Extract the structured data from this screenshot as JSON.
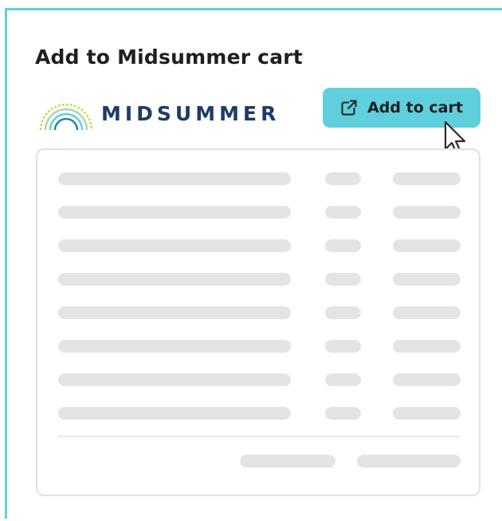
{
  "panel": {
    "title": "Add to Midsummer cart"
  },
  "brand": {
    "name": "MIDSUMMER",
    "logo_icon": "midsummer-arc-logo",
    "text_color": "#1e3c66",
    "arc_colors": [
      "#c9d94a",
      "#a8d8b0",
      "#5fcfdc",
      "#2f7fa8"
    ]
  },
  "add_button": {
    "label": "Add to cart",
    "icon": "external-link-icon",
    "background": "#5fcfdc"
  },
  "colors": {
    "accent": "#5fcfdc",
    "placeholder": "#e4e4e4",
    "border": "#e2e2e2"
  }
}
